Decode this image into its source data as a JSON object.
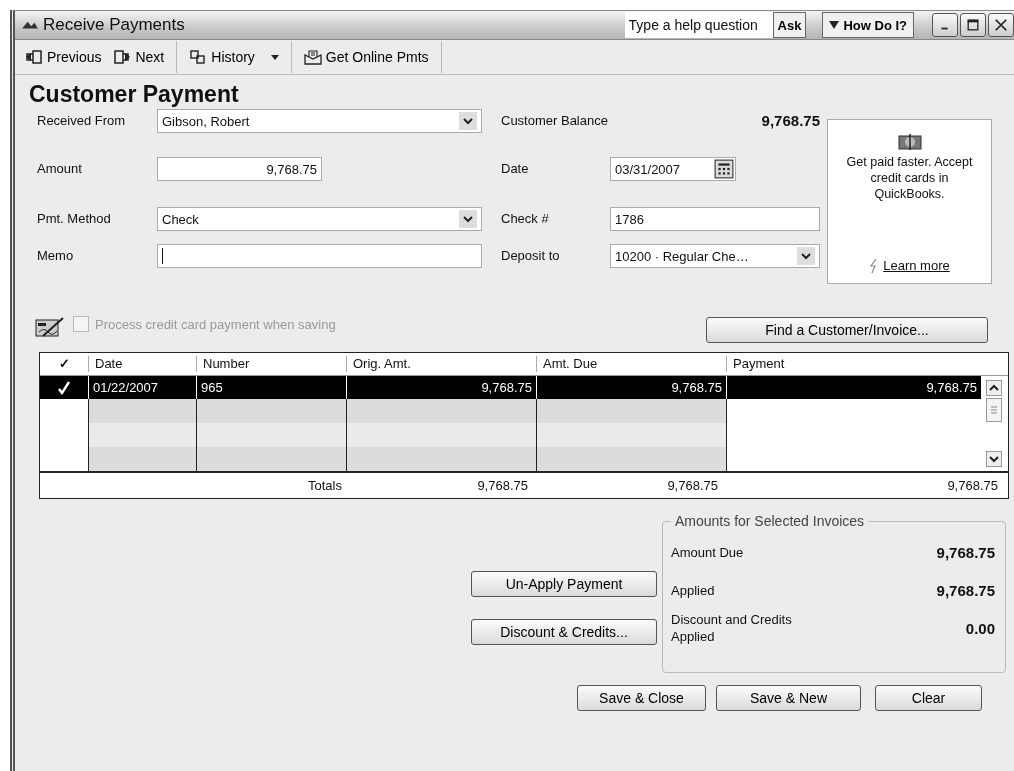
{
  "window": {
    "title": "Receive Payments"
  },
  "help": {
    "placeholder": "Type a help question",
    "ask": "Ask",
    "how_do_i": "How Do I?"
  },
  "toolbar": [
    {
      "label": "Previous",
      "kind": "prev"
    },
    {
      "label": "Next",
      "kind": "next"
    },
    {
      "label": "History",
      "kind": "history"
    },
    {
      "label": "Get Online Pmts",
      "kind": "online"
    }
  ],
  "heading": "Customer Payment",
  "fields_left": [
    {
      "label": "Received From",
      "value": "Gibson, Robert",
      "kind": "dropdown"
    },
    {
      "label": "Amount",
      "value": "9,768.75",
      "kind": "amount"
    },
    {
      "label": "Pmt. Method",
      "value": "Check",
      "kind": "dropdown"
    },
    {
      "label": "Memo",
      "kind": "text"
    }
  ],
  "customer_balance": {
    "label": "Customer Balance",
    "value": "9,768.75"
  },
  "fields_right": [
    {
      "label": "Date",
      "value": "03/31/2007",
      "kind": "date"
    },
    {
      "label": "Check #",
      "value": "1786",
      "kind": "text"
    },
    {
      "label": "Deposit to",
      "value": "10200 · Regular Che…",
      "kind": "dropdown"
    }
  ],
  "promo": {
    "text": "Get paid faster. Accept credit cards in QuickBooks.",
    "link": "Learn more"
  },
  "process_cc": {
    "label": "Process credit card payment when saving",
    "checked": false,
    "disabled": true
  },
  "find_button": "Find a Customer/Invoice...",
  "table": {
    "columns": [
      "✓",
      "Date",
      "Number",
      "Orig. Amt.",
      "Amt. Due",
      "Payment"
    ],
    "rows": [
      {
        "checked": true,
        "selected": true,
        "date": "01/22/2007",
        "number": "965",
        "orig_amt": "9,768.75",
        "amt_due": "9,768.75",
        "payment": "9,768.75"
      }
    ],
    "totals": {
      "label": "Totals",
      "orig_amt": "9,768.75",
      "amt_due": "9,768.75",
      "payment": "9,768.75"
    }
  },
  "summary": {
    "title": "Amounts for Selected Invoices",
    "rows": [
      {
        "label": "Amount Due",
        "value": "9,768.75"
      },
      {
        "label": "Applied",
        "value": "9,768.75"
      },
      {
        "label": "Discount and Credits Applied",
        "value": "0.00"
      }
    ]
  },
  "side_buttons": [
    "Un-Apply Payment",
    "Discount & Credits..."
  ],
  "bottom_buttons": [
    "Save & Close",
    "Save & New",
    "Clear"
  ]
}
